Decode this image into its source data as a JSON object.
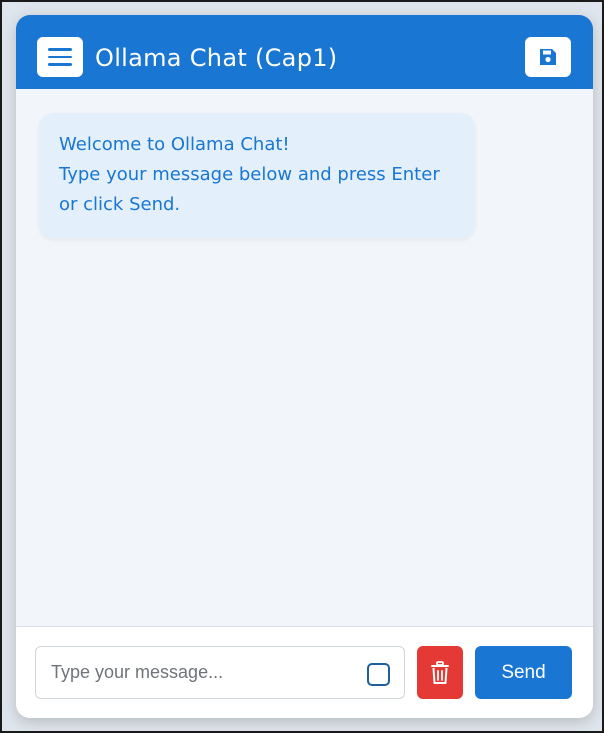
{
  "header": {
    "title": "Ollama Chat (Cap1)",
    "menu_icon": "hamburger-menu-icon",
    "save_icon": "floppy-disk-icon"
  },
  "messages": [
    {
      "role": "system",
      "lines": [
        "Welcome to Ollama Chat!",
        "Type your message below and press Enter",
        "or click Send."
      ]
    }
  ],
  "composer": {
    "input_value": "",
    "placeholder": "Type your message...",
    "checkbox_checked": false,
    "clear_icon": "trash-icon",
    "send_label": "Send"
  },
  "colors": {
    "primary": "#1976d2",
    "danger": "#e53935",
    "bubble_bg": "#e3f0fb",
    "chat_bg": "#f2f6fa"
  }
}
